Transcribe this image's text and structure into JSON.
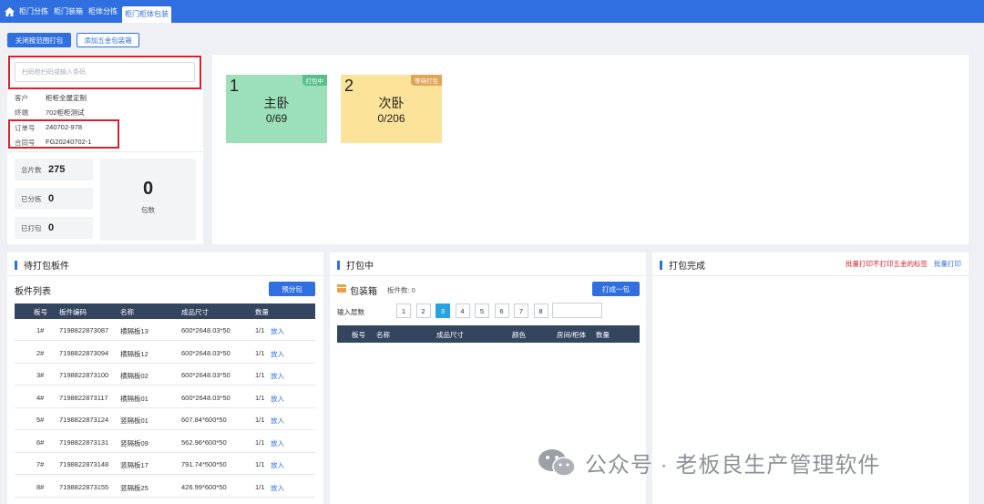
{
  "nav": {
    "tabs": [
      "柜门分拣",
      "柜门装箱",
      "柜体分拣"
    ],
    "active_tab": "柜门柜体包装"
  },
  "toolbar": {
    "close_pack": "关闭按范围打包",
    "add_hardware": "添加五金包装箱"
  },
  "scan": {
    "placeholder": "扫码枪扫码或输入条码"
  },
  "info": [
    {
      "k": "客户",
      "v": "柜柜全屋定制"
    },
    {
      "k": "终端",
      "v": "702柜柜测试"
    },
    {
      "k": "订单号",
      "v": "240702-978"
    },
    {
      "k": "合同号",
      "v": "FG20240702-1"
    }
  ],
  "stats": {
    "total_label": "总片数",
    "total": "275",
    "sorted_label": "已分拣",
    "sorted": "0",
    "packed_label": "已打包",
    "packed": "0",
    "packages_label": "包数",
    "packages": "0"
  },
  "rooms": [
    {
      "idx": "1",
      "badge": "打包中",
      "name": "主卧",
      "count": "0/69",
      "bg": "#9be0b8",
      "badge_color": "#58c08a"
    },
    {
      "idx": "2",
      "badge": "等待打包",
      "name": "次卧",
      "count": "0/206",
      "bg": "#fbe39a",
      "badge_color": "#e0a557"
    }
  ],
  "left": {
    "title": "待打包板件",
    "list_title": "板件列表",
    "prepack": "预分包",
    "headers": [
      "板号",
      "板件编码",
      "名称",
      "成品尺寸",
      "数量"
    ],
    "rows": [
      [
        "1#",
        "7198822873087",
        "横隔板13",
        "600*2648.03*50",
        "1/1",
        "放入"
      ],
      [
        "2#",
        "7198822873094",
        "横隔板12",
        "600*2648.03*50",
        "1/1",
        "放入"
      ],
      [
        "3#",
        "7198822873100",
        "横隔板02",
        "600*2648.03*50",
        "1/1",
        "放入"
      ],
      [
        "4#",
        "7198822873117",
        "横隔板01",
        "600*2648.03*50",
        "1/1",
        "放入"
      ],
      [
        "5#",
        "7198822873124",
        "竖隔板01",
        "607.84*600*50",
        "1/1",
        "放入"
      ],
      [
        "6#",
        "7198822873131",
        "竖隔板09",
        "562.96*600*50",
        "1/1",
        "放入"
      ],
      [
        "7#",
        "7198822873148",
        "竖隔板17",
        "791.74*500*50",
        "1/1",
        "放入"
      ],
      [
        "8#",
        "7198822873155",
        "竖隔板25",
        "426.99*600*50",
        "1/1",
        "放入"
      ]
    ]
  },
  "middle": {
    "title": "打包中",
    "box_label": "包装箱",
    "count_label": "板件数: 0",
    "pack_btn": "打成一包",
    "layer_label": "输入层数",
    "pages": [
      "1",
      "2",
      "3",
      "4",
      "5",
      "6",
      "7",
      "8"
    ],
    "active_page": "3",
    "headers": [
      "板号",
      "名称",
      "成品尺寸",
      "颜色",
      "房间/柜体",
      "数量"
    ]
  },
  "right": {
    "title": "打包完成",
    "batch_no_hw": "批量打印不打印五金的标签",
    "batch_print": "批量打印"
  },
  "watermark": {
    "text": "公众号 · 老板良生产管理软件"
  },
  "colors": {
    "primary": "#2f6fe0",
    "danger": "#d8202a",
    "header": "#34455f"
  }
}
